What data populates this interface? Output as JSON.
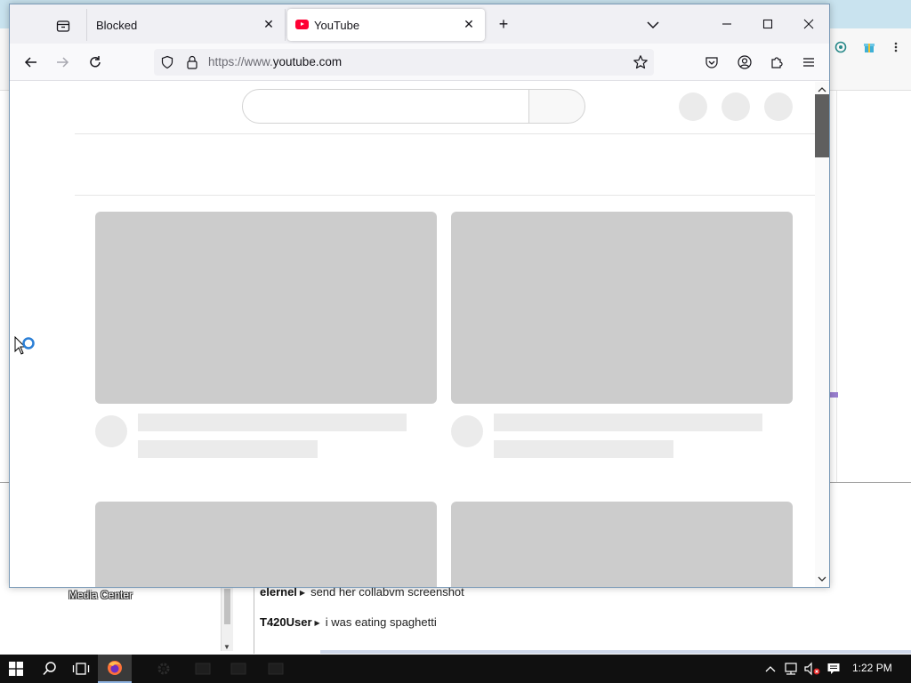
{
  "browser": {
    "tabs": [
      {
        "title": "Blocked",
        "active": false
      },
      {
        "title": "YouTube",
        "active": true
      }
    ],
    "url_prefix": "https://www.",
    "url_domain": "youtube.com"
  },
  "background": {
    "media_center_label": "Media Center",
    "chat": [
      {
        "user": "elernel",
        "message": "send her collabvm screenshot"
      },
      {
        "user": "T420User",
        "message": "i was eating spaghetti"
      }
    ]
  },
  "taskbar": {
    "time": "1:22 PM"
  },
  "colors": {
    "youtube_red": "#ff0033",
    "skeleton_thumbnail": "#cccccc",
    "skeleton_line": "#ebebeb",
    "taskbar": "#101010"
  }
}
